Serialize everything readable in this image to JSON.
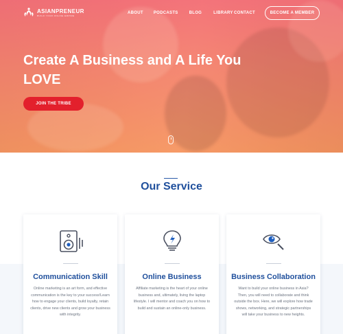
{
  "brand": {
    "name": "ASIANPRENEUR",
    "tagline": "BUILD YOUR ONLINE EMPIRE",
    "logo_icon": "leaf-people-logo-icon"
  },
  "nav": {
    "items": [
      "ABOUT",
      "PODCASTS",
      "BLOG",
      "LIBRARY",
      "CONTACT"
    ],
    "cta": "BECOME A MEMBER"
  },
  "hero": {
    "title": "Create A Business and A Life You LOVE",
    "button": "JOIN THE TRIBE",
    "scroll_icon": "mouse-scroll-icon"
  },
  "services": {
    "heading": "Our Service",
    "cards": [
      {
        "icon": "speaker-icon",
        "title": "Communication Skill",
        "text": "Online marketing is an art form, and effective communication is the key to your success!Learn how to engage your clients, build loyalty, retain clients, drive new clients and grow your business with integrity."
      },
      {
        "icon": "lightbulb-icon",
        "title": "Online Business",
        "text": "Affiliate marketing is the heart of your online business and, ultimately, living the laptop lifestyle. I will mentor and coach you on how to build and sustain an online-only business."
      },
      {
        "icon": "eye-search-icon",
        "title": "Business Collaboration",
        "text": "Want to build your online business in Asia? Then, you will need to collaborate and think outside the box. Here, we will explore how trade shows, networking, and strategic partnerships will take your business to new heights."
      }
    ]
  },
  "colors": {
    "accent_blue": "#1f4f9c",
    "cta_red": "#e3202c",
    "hero_gradient_top": "#f56e78",
    "hero_gradient_bottom": "#fa965f"
  }
}
